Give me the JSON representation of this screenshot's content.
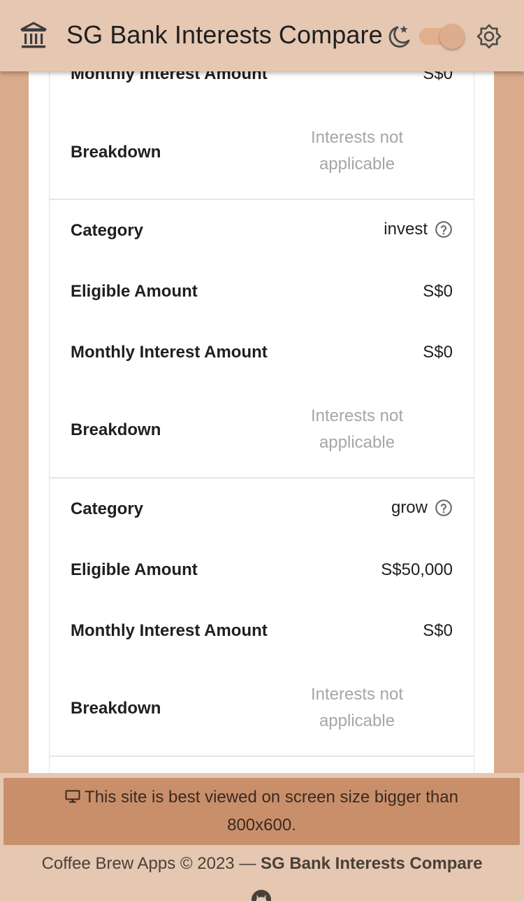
{
  "app": {
    "title": "SG Bank Interests Compare"
  },
  "icons": {
    "bank": "bank-icon",
    "moon": "moon-star-icon",
    "sun": "sun-icon",
    "help": "help-circle-icon",
    "monitor": "monitor-icon",
    "github": "github-icon"
  },
  "theme": {
    "dark_mode": false,
    "accent": "#c98f6b"
  },
  "partial_top": {
    "monthly_interest_label": "Monthly Interest Amount",
    "monthly_interest_value": "S$0",
    "breakdown_label": "Breakdown",
    "breakdown_line1": "Interests not",
    "breakdown_line2": "applicable"
  },
  "categories": [
    {
      "category_label": "Category",
      "category_value": "invest",
      "eligible_label": "Eligible Amount",
      "eligible_value": "S$0",
      "monthly_label": "Monthly Interest Amount",
      "monthly_value": "S$0",
      "breakdown_label": "Breakdown",
      "breakdown_line1": "Interests not",
      "breakdown_line2": "applicable"
    },
    {
      "category_label": "Category",
      "category_value": "grow",
      "eligible_label": "Eligible Amount",
      "eligible_value": "S$50,000",
      "monthly_label": "Monthly Interest Amount",
      "monthly_value": "S$0",
      "breakdown_label": "Breakdown",
      "breakdown_line1": "Interests not",
      "breakdown_line2": "applicable"
    }
  ],
  "banner": {
    "line1": "This site is best viewed on screen size bigger than",
    "line2": "800x600."
  },
  "footer": {
    "prefix": "Coffee Brew Apps © 2023 —",
    "app_name": "SG Bank Interests Compare"
  }
}
